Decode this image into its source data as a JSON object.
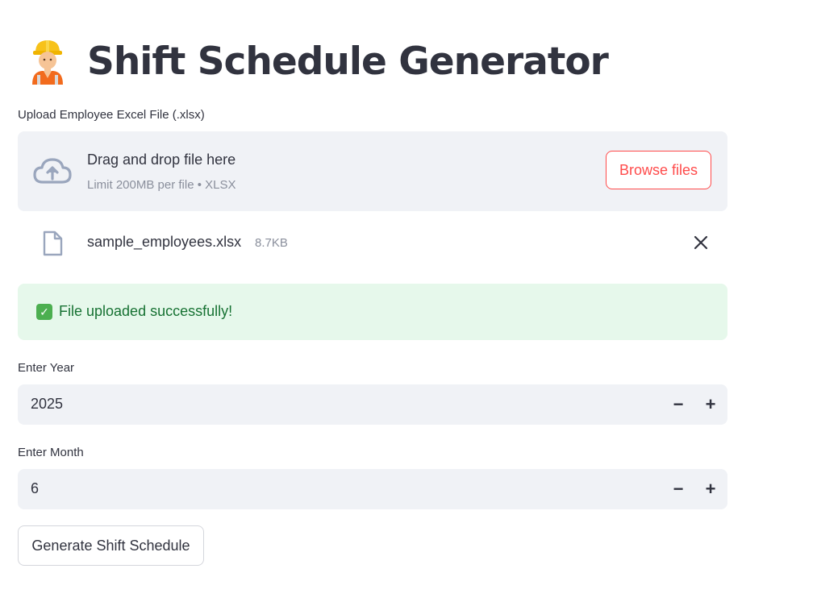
{
  "header": {
    "title": "Shift Schedule Generator",
    "icon": "construction-worker-emoji"
  },
  "uploader": {
    "label": "Upload Employee Excel File (.xlsx)",
    "drop_title": "Drag and drop file here",
    "drop_subtitle": "Limit 200MB per file • XLSX",
    "browse_label": "Browse files",
    "icon": "cloud-upload-icon"
  },
  "uploaded_file": {
    "name": "sample_employees.xlsx",
    "size": "8.7KB",
    "icon": "file-icon",
    "remove_icon": "close-icon"
  },
  "alert": {
    "text": "File uploaded successfully!",
    "icon": "check-box-icon"
  },
  "year_input": {
    "label": "Enter Year",
    "value": "2025",
    "minus": "−",
    "plus": "+"
  },
  "month_input": {
    "label": "Enter Month",
    "value": "6",
    "minus": "−",
    "plus": "+"
  },
  "actions": {
    "generate_label": "Generate Shift Schedule"
  },
  "colors": {
    "accent": "#ff4b4b",
    "text": "#31333f",
    "muted": "#8a8f9c",
    "input_bg": "#f0f2f6",
    "success_bg": "#e6f8eb",
    "success_text": "#177233"
  }
}
